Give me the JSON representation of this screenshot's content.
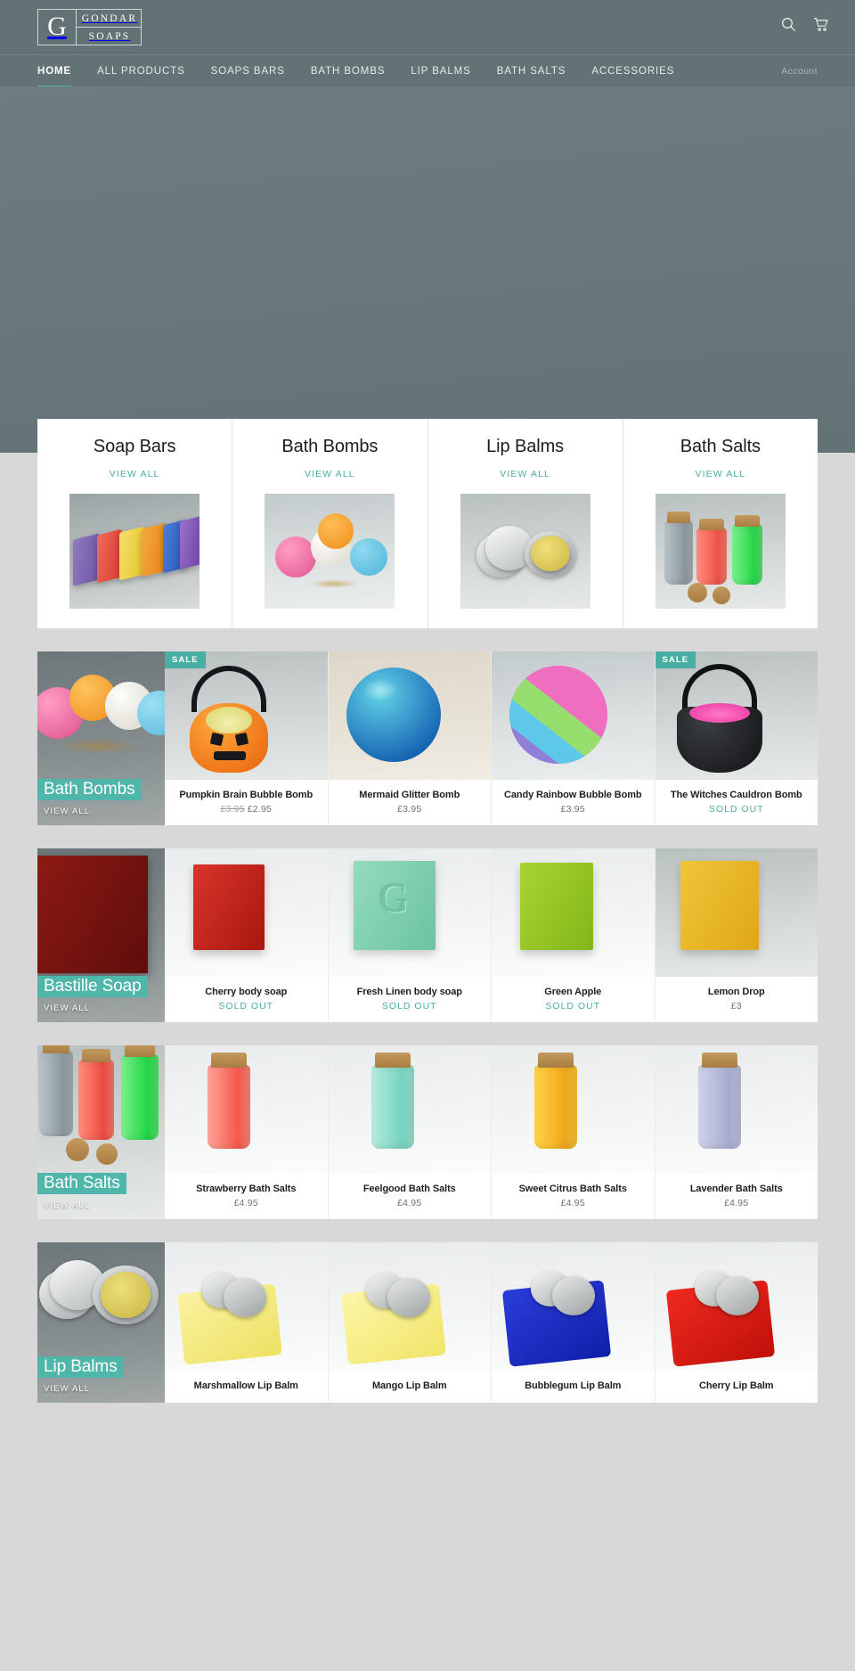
{
  "header": {
    "logo": {
      "initial": "G",
      "line1": "GONDAR",
      "line2": "SOAPS"
    },
    "icons": {
      "search": "search-icon",
      "cart": "cart-icon"
    },
    "account_label": "Account"
  },
  "nav": {
    "items": [
      {
        "label": "HOME",
        "active": true
      },
      {
        "label": "ALL PRODUCTS",
        "active": false
      },
      {
        "label": "SOAPS BARS",
        "active": false
      },
      {
        "label": "BATH BOMBS",
        "active": false
      },
      {
        "label": "LIP BALMS",
        "active": false
      },
      {
        "label": "BATH SALTS",
        "active": false
      },
      {
        "label": "ACCESSORIES",
        "active": false
      }
    ]
  },
  "category_cards": [
    {
      "title": "Soap Bars",
      "view_all": "VIEW ALL"
    },
    {
      "title": "Bath Bombs",
      "view_all": "VIEW ALL"
    },
    {
      "title": "Lip Balms",
      "view_all": "VIEW ALL"
    },
    {
      "title": "Bath Salts",
      "view_all": "VIEW ALL"
    }
  ],
  "collections": [
    {
      "name": "Bath Bombs",
      "view_all": "VIEW ALL",
      "products": [
        {
          "title": "Pumpkin Brain Bubble Bomb",
          "badge": "SALE",
          "price_was": "£3.95",
          "price": "£2.95",
          "sold_out": ""
        },
        {
          "title": "Mermaid Glitter Bomb",
          "badge": "",
          "price_was": "",
          "price": "£3.95",
          "sold_out": ""
        },
        {
          "title": "Candy Rainbow Bubble Bomb",
          "badge": "",
          "price_was": "",
          "price": "£3.95",
          "sold_out": ""
        },
        {
          "title": "The Witches Cauldron Bomb",
          "badge": "SALE",
          "price_was": "",
          "price": "",
          "sold_out": "SOLD OUT"
        }
      ]
    },
    {
      "name": "Bastille Soap",
      "view_all": "VIEW ALL",
      "products": [
        {
          "title": "Cherry body soap",
          "badge": "",
          "price_was": "",
          "price": "",
          "sold_out": "SOLD OUT"
        },
        {
          "title": "Fresh Linen body soap",
          "badge": "",
          "price_was": "",
          "price": "",
          "sold_out": "SOLD OUT"
        },
        {
          "title": "Green Apple",
          "badge": "",
          "price_was": "",
          "price": "",
          "sold_out": "SOLD OUT"
        },
        {
          "title": "Lemon Drop",
          "badge": "",
          "price_was": "",
          "price": "£3",
          "sold_out": ""
        }
      ]
    },
    {
      "name": "Bath Salts",
      "view_all": "VIEW ALL",
      "products": [
        {
          "title": "Strawberry Bath Salts",
          "badge": "",
          "price_was": "",
          "price": "£4.95",
          "sold_out": ""
        },
        {
          "title": "Feelgood Bath Salts",
          "badge": "",
          "price_was": "",
          "price": "£4.95",
          "sold_out": ""
        },
        {
          "title": "Sweet Citrus Bath Salts",
          "badge": "",
          "price_was": "",
          "price": "£4.95",
          "sold_out": ""
        },
        {
          "title": "Lavender Bath Salts",
          "badge": "",
          "price_was": "",
          "price": "£4.95",
          "sold_out": ""
        }
      ]
    },
    {
      "name": "Lip Balms",
      "view_all": "VIEW ALL",
      "products": [
        {
          "title": "Marshmallow Lip Balm",
          "badge": "",
          "price_was": "",
          "price": "",
          "sold_out": ""
        },
        {
          "title": "Mango Lip Balm",
          "badge": "",
          "price_was": "",
          "price": "",
          "sold_out": ""
        },
        {
          "title": "Bubblegum Lip Balm",
          "badge": "",
          "price_was": "",
          "price": "",
          "sold_out": ""
        },
        {
          "title": "Cherry Lip Balm",
          "badge": "",
          "price_was": "",
          "price": "",
          "sold_out": ""
        }
      ]
    }
  ],
  "colors": {
    "header_bg": "#637275",
    "accent_teal": "#4aafa3",
    "overlay_teal": "#50b6a9",
    "page_bg": "#d8d8d8",
    "card_bg": "#ffffff",
    "text_dark": "#1f1f1f",
    "text_muted": "#888b8b"
  }
}
